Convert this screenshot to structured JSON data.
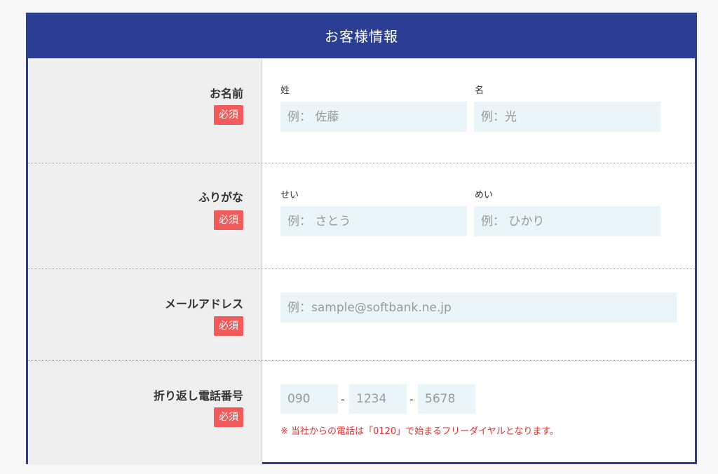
{
  "section": {
    "title": "お客様情報"
  },
  "required_badge": "必須",
  "name": {
    "label": "お名前",
    "last": {
      "label": "姓",
      "placeholder": "例： 佐藤"
    },
    "first": {
      "label": "名",
      "placeholder": "例：光"
    }
  },
  "kana": {
    "label": "ふりがな",
    "last": {
      "label": "せい",
      "placeholder": "例： さとう"
    },
    "first": {
      "label": "めい",
      "placeholder": "例： ひかり"
    }
  },
  "email": {
    "label": "メールアドレス",
    "placeholder": "例：sample@softbank.ne.jp"
  },
  "phone": {
    "label": "折り返し電話番号",
    "part1_placeholder": "090",
    "part2_placeholder": "1234",
    "part3_placeholder": "5678",
    "separator": "-",
    "note": "※ 当社からの電話は「0120」で始まるフリーダイヤルとなります。"
  },
  "colors": {
    "header": "#2c3e94",
    "badge": "#f25b5b",
    "input_bg": "#eaf5fa",
    "note": "#e03030"
  }
}
